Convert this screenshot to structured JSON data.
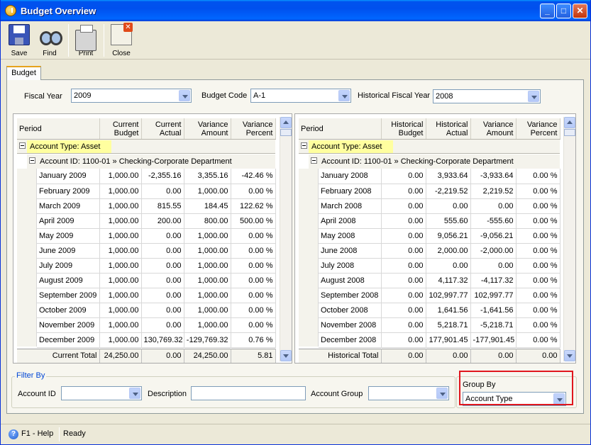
{
  "window": {
    "title": "Budget Overview"
  },
  "toolbar": {
    "save": "Save",
    "find": "Find",
    "print": "Print",
    "close": "Close"
  },
  "tab": {
    "label": "Budget"
  },
  "form": {
    "fiscal_year_label": "Fiscal Year",
    "fiscal_year": "2009",
    "budget_code_label": "Budget Code",
    "budget_code": "A-1",
    "historical_fy_label": "Historical Fiscal Year",
    "historical_fy": "2008"
  },
  "left_grid": {
    "headers": {
      "period": "Period",
      "c1a": "Current",
      "c1b": "Budget",
      "c2a": "Current",
      "c2b": "Actual",
      "c3a": "Variance",
      "c3b": "Amount",
      "c4a": "Variance",
      "c4b": "Percent"
    },
    "group": "Account Type: Asset",
    "subgroup": "Account ID: 1100-01 » Checking-Corporate Department",
    "rows": [
      [
        "January 2009",
        "1,000.00",
        "-2,355.16",
        "3,355.16",
        "-42.46 %"
      ],
      [
        "February 2009",
        "1,000.00",
        "0.00",
        "1,000.00",
        "0.00 %"
      ],
      [
        "March 2009",
        "1,000.00",
        "815.55",
        "184.45",
        "122.62 %"
      ],
      [
        "April 2009",
        "1,000.00",
        "200.00",
        "800.00",
        "500.00 %"
      ],
      [
        "May 2009",
        "1,000.00",
        "0.00",
        "1,000.00",
        "0.00 %"
      ],
      [
        "June 2009",
        "1,000.00",
        "0.00",
        "1,000.00",
        "0.00 %"
      ],
      [
        "July 2009",
        "1,000.00",
        "0.00",
        "1,000.00",
        "0.00 %"
      ],
      [
        "August 2009",
        "1,000.00",
        "0.00",
        "1,000.00",
        "0.00 %"
      ],
      [
        "September 2009",
        "1,000.00",
        "0.00",
        "1,000.00",
        "0.00 %"
      ],
      [
        "October 2009",
        "1,000.00",
        "0.00",
        "1,000.00",
        "0.00 %"
      ],
      [
        "November 2009",
        "1,000.00",
        "0.00",
        "1,000.00",
        "0.00 %"
      ],
      [
        "December 2009",
        "1,000.00",
        "130,769.32",
        "-129,769.32",
        "0.76 %"
      ]
    ],
    "footer": [
      "Current Total",
      "24,250.00",
      "0.00",
      "24,250.00",
      "5.81"
    ]
  },
  "right_grid": {
    "headers": {
      "period": "Period",
      "c1a": "Historical",
      "c1b": "Budget",
      "c2a": "Historical",
      "c2b": "Actual",
      "c3a": "Variance",
      "c3b": "Amount",
      "c4a": "Variance",
      "c4b": "Percent"
    },
    "group": "Account Type: Asset",
    "subgroup": "Account ID: 1100-01 » Checking-Corporate Department",
    "rows": [
      [
        "January 2008",
        "0.00",
        "3,933.64",
        "-3,933.64",
        "0.00 %"
      ],
      [
        "February 2008",
        "0.00",
        "-2,219.52",
        "2,219.52",
        "0.00 %"
      ],
      [
        "March 2008",
        "0.00",
        "0.00",
        "0.00",
        "0.00 %"
      ],
      [
        "April 2008",
        "0.00",
        "555.60",
        "-555.60",
        "0.00 %"
      ],
      [
        "May 2008",
        "0.00",
        "9,056.21",
        "-9,056.21",
        "0.00 %"
      ],
      [
        "June 2008",
        "0.00",
        "2,000.00",
        "-2,000.00",
        "0.00 %"
      ],
      [
        "July 2008",
        "0.00",
        "0.00",
        "0.00",
        "0.00 %"
      ],
      [
        "August 2008",
        "0.00",
        "4,117.32",
        "-4,117.32",
        "0.00 %"
      ],
      [
        "September 2008",
        "0.00",
        "102,997.77",
        "102,997.77",
        "0.00 %"
      ],
      [
        "October 2008",
        "0.00",
        "1,641.56",
        "-1,641.56",
        "0.00 %"
      ],
      [
        "November 2008",
        "0.00",
        "5,218.71",
        "-5,218.71",
        "0.00 %"
      ],
      [
        "December 2008",
        "0.00",
        "177,901.45",
        "-177,901.45",
        "0.00 %"
      ]
    ],
    "footer": [
      "Historical Total",
      "0.00",
      "0.00",
      "0.00",
      "0.00"
    ]
  },
  "filter": {
    "legend": "Filter By",
    "account_id_label": "Account ID",
    "account_id": "",
    "description_label": "Description",
    "description": "",
    "account_group_label": "Account Group",
    "account_group": ""
  },
  "group_by": {
    "legend": "Group By",
    "value": "Account Type"
  },
  "status": {
    "help": "F1 - Help",
    "state": "Ready"
  }
}
